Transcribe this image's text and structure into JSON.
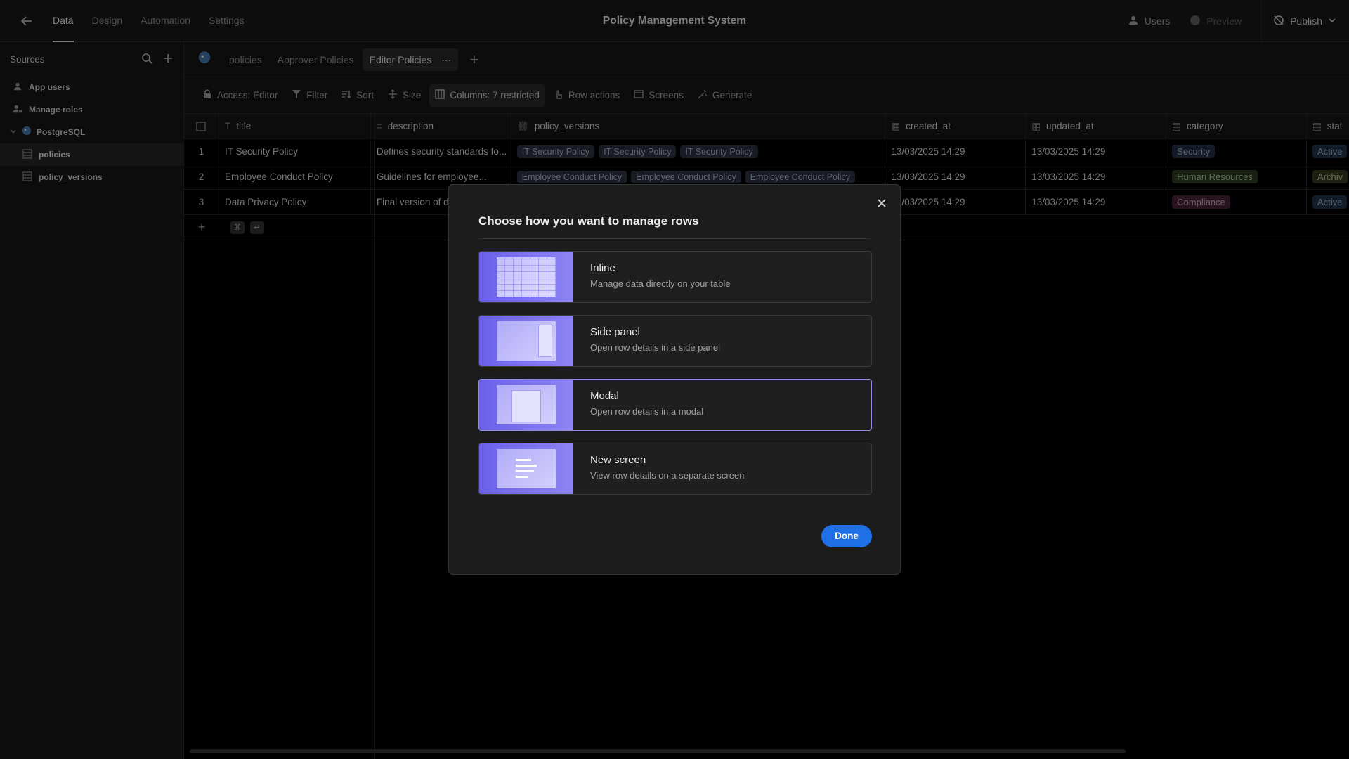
{
  "topbar": {
    "tabs": [
      "Data",
      "Design",
      "Automation",
      "Settings"
    ],
    "app_title": "Policy Management System",
    "users_label": "Users",
    "preview_label": "Preview",
    "publish_label": "Publish"
  },
  "sidebar": {
    "title": "Sources",
    "items": {
      "app_users": "App users",
      "manage_roles": "Manage roles",
      "datasource": "PostgreSQL",
      "table1": "policies",
      "table2": "policy_versions"
    }
  },
  "tabs": {
    "items": [
      "policies",
      "Approver Policies",
      "Editor Policies"
    ],
    "active_more": "···"
  },
  "toolbar": {
    "access": "Access: Editor",
    "filter": "Filter",
    "sort": "Sort",
    "size": "Size",
    "columns": "Columns: 7 restricted",
    "row_actions": "Row actions",
    "screens": "Screens",
    "generate": "Generate"
  },
  "grid": {
    "columns": [
      "title",
      "description",
      "policy_versions",
      "created_at",
      "updated_at",
      "category",
      "stat"
    ],
    "rows": [
      {
        "num": "1",
        "title": "IT Security Policy",
        "description": "Defines security standards fo...",
        "versions": [
          "IT Security Policy",
          "IT Security Policy",
          "IT Security Policy"
        ],
        "created_at": "13/03/2025 14:29",
        "updated_at": "13/03/2025 14:29",
        "category": "Security",
        "status": "Active"
      },
      {
        "num": "2",
        "title": "Employee Conduct Policy",
        "description": "Guidelines for employee...",
        "versions": [
          "Employee Conduct Policy",
          "Employee Conduct Policy",
          "Employee Conduct Policy"
        ],
        "created_at": "13/03/2025 14:29",
        "updated_at": "13/03/2025 14:29",
        "category": "Human Resources",
        "status": "Archiv"
      },
      {
        "num": "3",
        "title": "Data Privacy Policy",
        "description": "Final version of d",
        "versions": [],
        "created_at": "13/03/2025 14:29",
        "updated_at": "13/03/2025 14:29",
        "category": "Compliance",
        "status": "Active"
      }
    ],
    "kbd": [
      "⌘",
      "↵"
    ]
  },
  "modal": {
    "title": "Choose how you want to manage rows",
    "options": [
      {
        "label": "Inline",
        "sub": "Manage data directly on your table"
      },
      {
        "label": "Side panel",
        "sub": "Open row details in a side panel"
      },
      {
        "label": "Modal",
        "sub": "Open row details in a modal"
      },
      {
        "label": "New screen",
        "sub": "View row details on a separate screen"
      }
    ],
    "selected_index": 2,
    "done_label": "Done"
  },
  "colors": {
    "accent": "#1f6fe6",
    "thumb": "#7a70ee"
  }
}
